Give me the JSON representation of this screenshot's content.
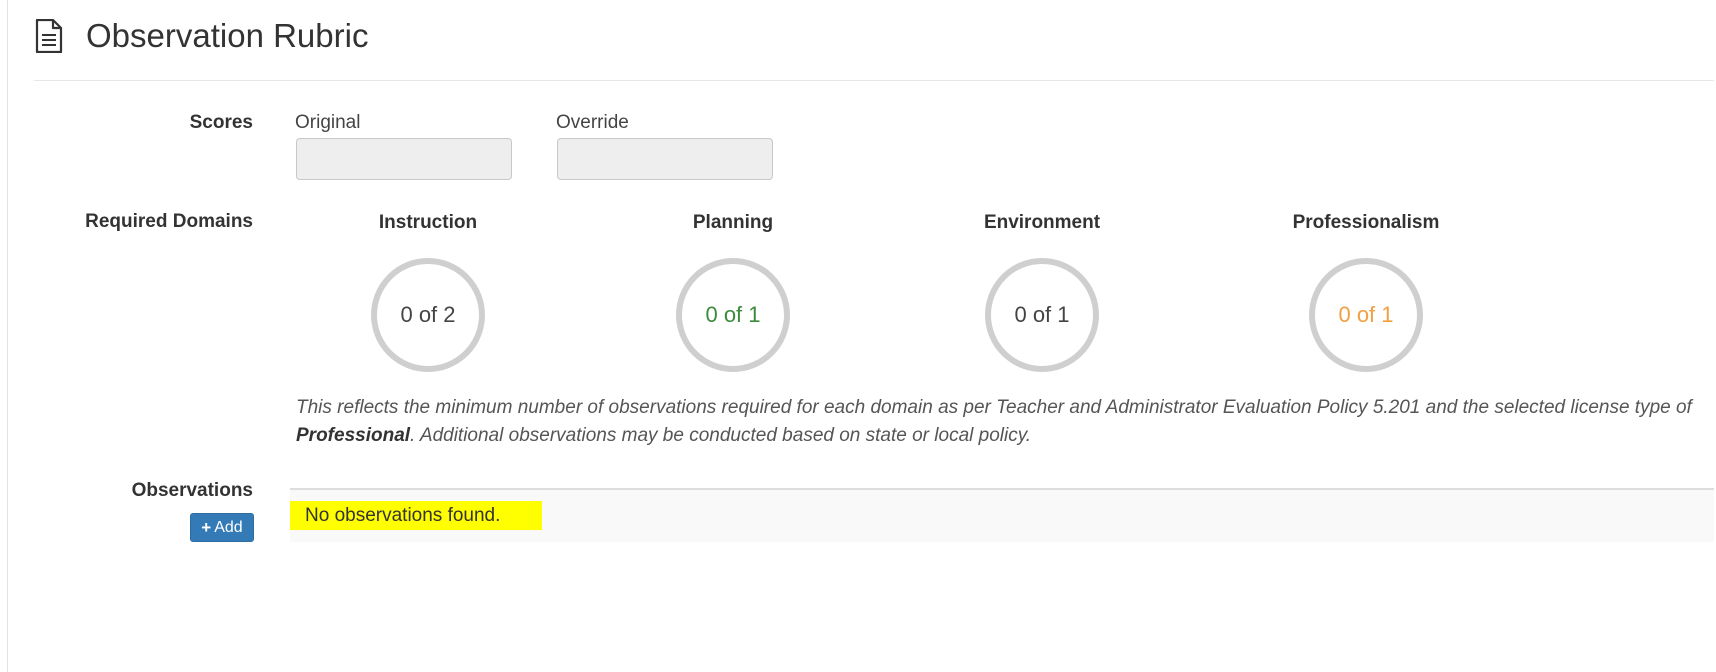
{
  "header": {
    "title": "Observation Rubric",
    "icon": "document-icon"
  },
  "scores": {
    "label": "Scores",
    "original_label": "Original",
    "original_value": "",
    "override_label": "Override",
    "override_value": ""
  },
  "required_domains": {
    "label": "Required Domains",
    "domains": [
      {
        "name": "Instruction",
        "progress": "0 of 2",
        "color": "#444444"
      },
      {
        "name": "Planning",
        "progress": "0 of 1",
        "color": "#3c8a3c"
      },
      {
        "name": "Environment",
        "progress": "0 of 1",
        "color": "#444444"
      },
      {
        "name": "Professionalism",
        "progress": "0 of 1",
        "color": "#f0a040"
      }
    ],
    "note_before": "This reflects the minimum number of observations required for each domain as per Teacher and Administrator Evaluation Policy 5.201 and the selected license type of ",
    "note_license": "Professional",
    "note_after": ". Additional observations may be conducted based on state or local policy."
  },
  "observations": {
    "label": "Observations",
    "add_label": "Add",
    "add_icon": "plus-icon",
    "empty_message": "No observations found."
  },
  "colors": {
    "accent": "#337ab7",
    "highlight": "#ffff00",
    "ring": "#cfcfcf"
  }
}
